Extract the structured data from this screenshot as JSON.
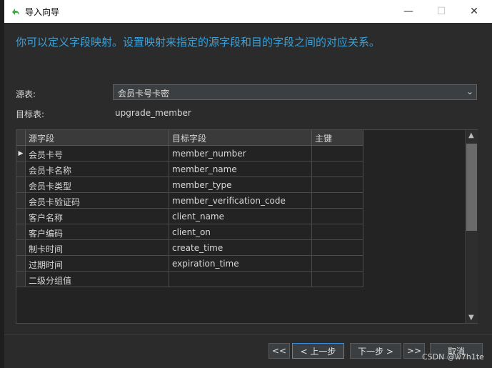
{
  "window": {
    "title": "导入向导",
    "minimize_glyph": "—",
    "maximize_glyph": "☐",
    "close_glyph": "✕",
    "icon": "import-wizard-icon"
  },
  "heading": "你可以定义字段映射。设置映射来指定的源字段和目的字段之间的对应关系。",
  "source_table": {
    "label": "源表:",
    "value": "会员卡号卡密"
  },
  "target_table": {
    "label": "目标表:",
    "value": "upgrade_member"
  },
  "grid": {
    "columns": [
      "源字段",
      "目标字段",
      "主键"
    ],
    "rows": [
      {
        "source": "会员卡号",
        "target": "member_number",
        "pk": ""
      },
      {
        "source": "会员卡名称",
        "target": "member_name",
        "pk": ""
      },
      {
        "source": "会员卡类型",
        "target": "member_type",
        "pk": ""
      },
      {
        "source": "会员卡验证码",
        "target": "member_verification_code",
        "pk": ""
      },
      {
        "source": "客户名称",
        "target": "client_name",
        "pk": ""
      },
      {
        "source": "客户编码",
        "target": "client_on",
        "pk": ""
      },
      {
        "source": "制卡时间",
        "target": "create_time",
        "pk": ""
      },
      {
        "source": "过期时间",
        "target": "expiration_time",
        "pk": ""
      },
      {
        "source": "二级分组值",
        "target": "",
        "pk": ""
      }
    ],
    "current_row_marker": "▶"
  },
  "buttons": {
    "first": "<<",
    "prev": "< 上一步",
    "next": "下一步 >",
    "last": ">>",
    "cancel": "取消"
  },
  "watermark": "CSDN @w7h1te",
  "colors": {
    "heading": "#3aa0d8",
    "focus": "#3a8ee0"
  }
}
